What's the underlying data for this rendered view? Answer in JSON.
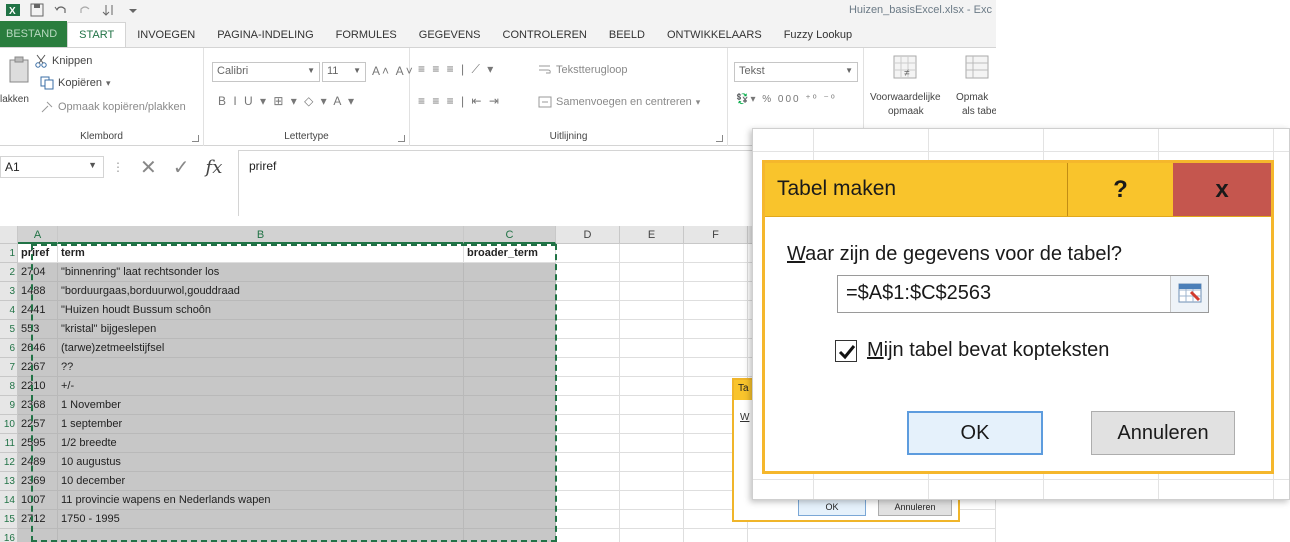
{
  "window": {
    "title": "Huizen_basisExcel.xlsx - Exc"
  },
  "ribbon_tabs": [
    "BESTAND",
    "START",
    "INVOEGEN",
    "PAGINA-INDELING",
    "FORMULES",
    "GEGEVENS",
    "CONTROLEREN",
    "BEELD",
    "ONTWIKKELAARS",
    "Fuzzy Lookup"
  ],
  "clipboard": {
    "paste": "lakken",
    "cut": "Knippen",
    "copy": "Kopiëren",
    "format_painter": "Opmaak kopiëren/plakken",
    "label": "Klembord"
  },
  "font_group": {
    "font_name": "Calibri",
    "font_size": "11",
    "label": "Lettertype"
  },
  "alignment_group": {
    "wrap_text": "Tekstterugloop",
    "merge_center": "Samenvoegen en centreren",
    "label": "Uitlijning"
  },
  "number_group": {
    "format": "Tekst"
  },
  "styles_group": {
    "conditional_line1": "Voorwaardelijke",
    "conditional_line2": "opmaak",
    "format_table_line1": "Opmak",
    "format_table_line2": "als tabe"
  },
  "formula_bar": {
    "name_box": "A1",
    "formula": "priref"
  },
  "grid": {
    "columns": [
      "A",
      "B",
      "C",
      "D",
      "E",
      "F"
    ],
    "row_numbers": [
      "1",
      "2",
      "3",
      "4",
      "5",
      "6",
      "7",
      "8",
      "9",
      "10",
      "11",
      "12",
      "13",
      "14",
      "15",
      "16"
    ],
    "header_row": [
      "priref",
      "term",
      "broader_term"
    ],
    "rows": [
      [
        "2704",
        "\"binnenring\" laat rechtsonder los",
        ""
      ],
      [
        "1488",
        "\"borduurgaas,borduurwol,gouddraad",
        ""
      ],
      [
        "2441",
        "\"Huizen houdt Bussum schoôn",
        ""
      ],
      [
        "553",
        "\"kristal\" bijgeslepen",
        ""
      ],
      [
        "2646",
        "(tarwe)zetmeelstijfsel",
        ""
      ],
      [
        "2267",
        "??",
        ""
      ],
      [
        "2210",
        "+/-",
        ""
      ],
      [
        "2368",
        "1 November",
        ""
      ],
      [
        "2257",
        "1 september",
        ""
      ],
      [
        "2595",
        "1/2 breedte",
        ""
      ],
      [
        "2489",
        "10 augustus",
        ""
      ],
      [
        "2369",
        "10 december",
        ""
      ],
      [
        "1007",
        "11 provincie wapens en Nederlands wapen",
        ""
      ],
      [
        "2712",
        "1750 - 1995",
        ""
      ],
      [
        "",
        "",
        ""
      ]
    ]
  },
  "small_dialog": {
    "title": "Ta",
    "text": "W",
    "ok": "OK",
    "cancel": "Annuleren"
  },
  "dialog": {
    "title": "Tabel maken",
    "help": "?",
    "close": "x",
    "question_accel": "W",
    "question_rest": "aar zijn de gegevens voor de tabel?",
    "range": "=$A$1:$C$2563",
    "checkbox_accel": "M",
    "checkbox_rest": "ijn tabel bevat kopteksten",
    "checkbox_checked": true,
    "ok": "OK",
    "cancel": "Annuleren"
  }
}
